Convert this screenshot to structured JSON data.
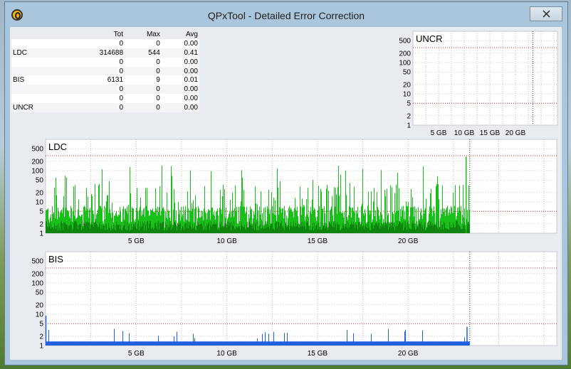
{
  "window": {
    "title": "QPxTool - Detailed Error Correction"
  },
  "stats": {
    "headers": [
      "",
      "Tot",
      "Max",
      "Avg"
    ],
    "rows": [
      {
        "label": "",
        "tot": "0",
        "max": "0",
        "avg": "0.00"
      },
      {
        "label": "LDC",
        "tot": "314688",
        "max": "544",
        "avg": "0.41"
      },
      {
        "label": "",
        "tot": "0",
        "max": "0",
        "avg": "0.00"
      },
      {
        "label": "",
        "tot": "0",
        "max": "0",
        "avg": "0.00"
      },
      {
        "label": "BIS",
        "tot": "6131",
        "max": "9",
        "avg": "0.01"
      },
      {
        "label": "",
        "tot": "0",
        "max": "0",
        "avg": "0.00"
      },
      {
        "label": "",
        "tot": "0",
        "max": "0",
        "avg": "0.00"
      },
      {
        "label": "UNCR",
        "tot": "0",
        "max": "0",
        "avg": "0.00"
      }
    ]
  },
  "colors": {
    "ldc_bars": "#19c019",
    "ldc_dark": "#0b6b0b",
    "bis_bars": "#1f5fe0",
    "threshold": "#cc3333"
  },
  "chart_data": [
    {
      "type": "bar",
      "title": "UNCR",
      "y_scale": "log",
      "y_ticks": [
        "500",
        "200",
        "100",
        "50",
        "20",
        "10",
        "5",
        "2",
        "1"
      ],
      "x_ticks": [
        "5 GB",
        "10 GB",
        "15 GB",
        "20 GB"
      ],
      "x_range_gb": [
        0,
        23.4
      ],
      "series": [
        {
          "values": []
        }
      ]
    },
    {
      "type": "bar",
      "title": "LDC",
      "y_scale": "log",
      "y_ticks": [
        "500",
        "200",
        "100",
        "50",
        "20",
        "10",
        "5",
        "2",
        "1"
      ],
      "x_ticks": [
        "5 GB",
        "10 GB",
        "15 GB",
        "20 GB"
      ],
      "x_range_gb": [
        0,
        23.4
      ],
      "max": 544
    },
    {
      "type": "bar",
      "title": "BIS",
      "y_scale": "log",
      "y_ticks": [
        "500",
        "200",
        "100",
        "50",
        "20",
        "10",
        "5",
        "2",
        "1"
      ],
      "x_ticks": [
        "5 GB",
        "10 GB",
        "15 GB",
        "20 GB"
      ],
      "x_range_gb": [
        0,
        23.4
      ],
      "max": 9
    }
  ]
}
